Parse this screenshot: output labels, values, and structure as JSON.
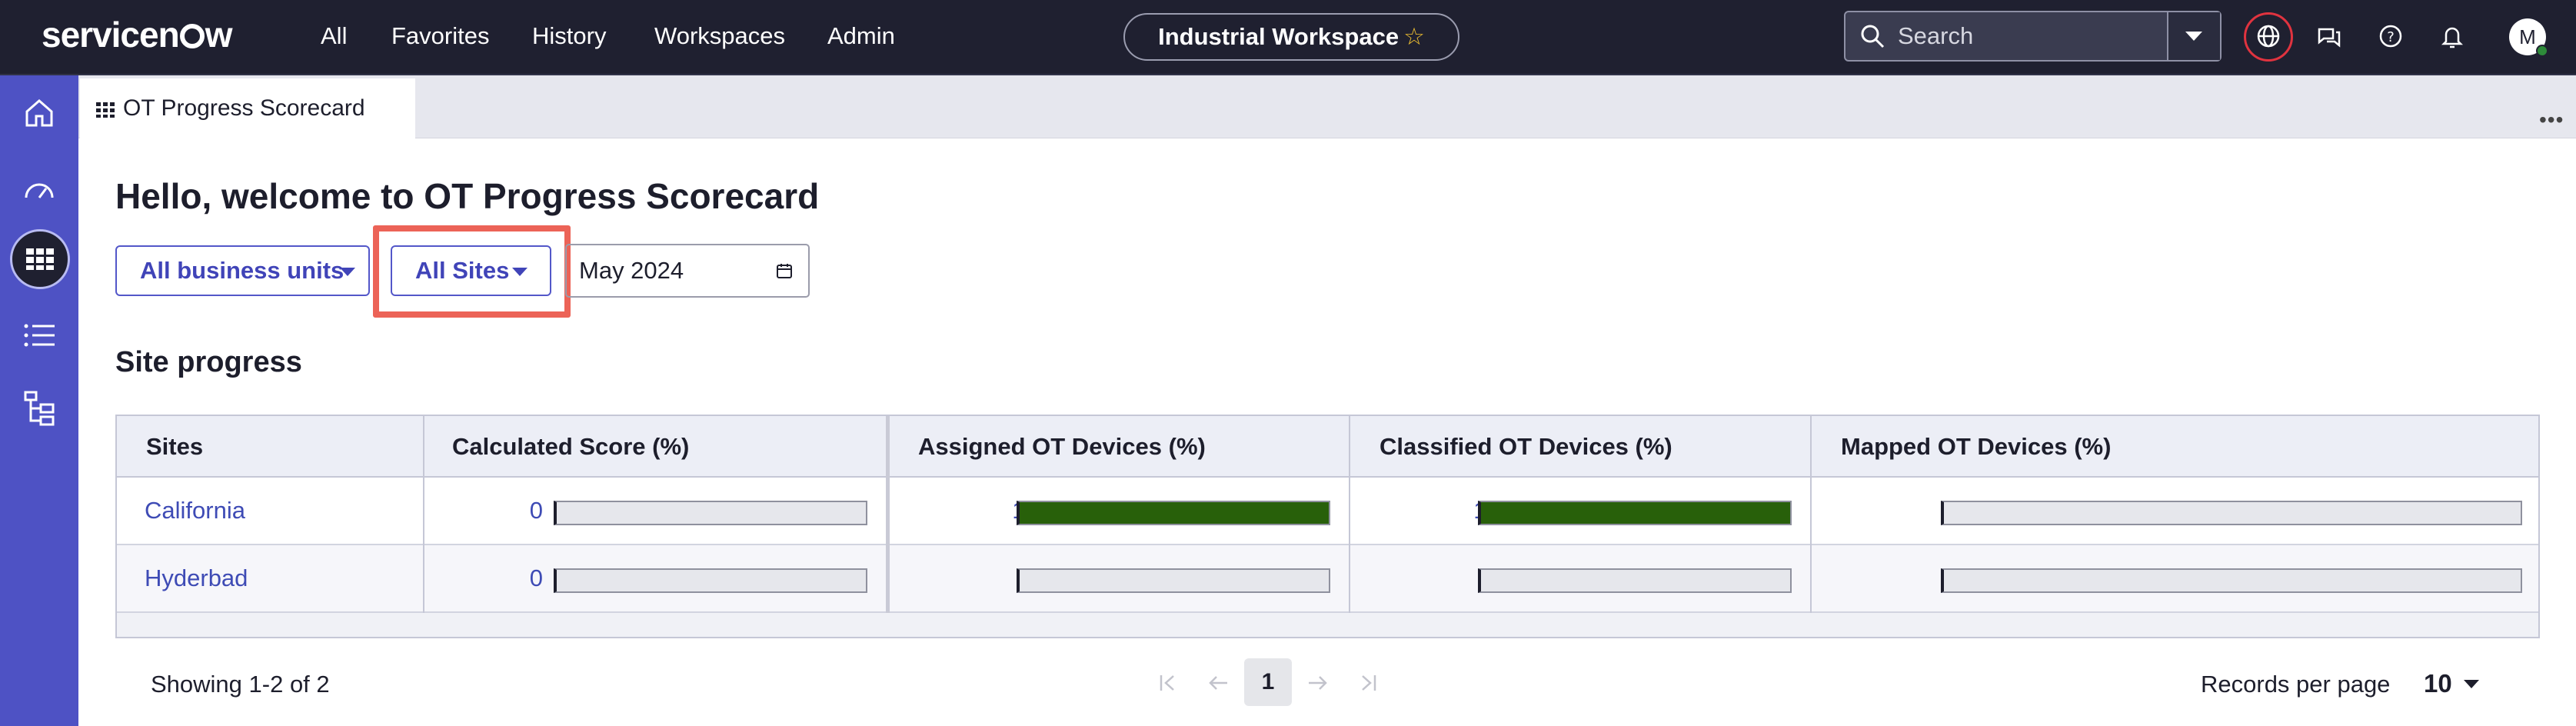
{
  "header": {
    "logo": "servicenow",
    "nav": [
      "All",
      "Favorites",
      "History",
      "Workspaces",
      "Admin"
    ],
    "workspace_pill": "Industrial Workspace",
    "search_placeholder": "Search",
    "avatar_initial": "M",
    "icons": [
      "globe-icon",
      "chat-icon",
      "help-icon",
      "bell-icon"
    ]
  },
  "sidebar": {
    "icons": [
      "home-icon",
      "dashboard-gauge-icon",
      "grid-icon",
      "list-icon",
      "hierarchy-icon"
    ],
    "active": "grid-icon"
  },
  "tab": {
    "label": "OT Progress Scorecard"
  },
  "page": {
    "title": "Hello, welcome to OT Progress Scorecard",
    "filters": {
      "business_units": "All business units",
      "sites": "All Sites",
      "date": "May 2024"
    },
    "section_title": "Site progress"
  },
  "table": {
    "columns": [
      "Sites",
      "Calculated Score (%)",
      "Assigned OT Devices (%)",
      "Classified OT Devices (%)",
      "Mapped OT Devices (%)"
    ],
    "rows": [
      {
        "site": "California",
        "calculated": "0",
        "assigned": "100",
        "classified": "100",
        "mapped": "0"
      },
      {
        "site": "Hyderbad",
        "calculated": "0",
        "assigned": "0",
        "classified": "0",
        "mapped": "0"
      }
    ],
    "bar_color": "#28600a"
  },
  "footer": {
    "showing": "Showing 1-2 of 2",
    "current_page": "1",
    "records_per_page_label": "Records per page",
    "records_per_page": "10"
  }
}
